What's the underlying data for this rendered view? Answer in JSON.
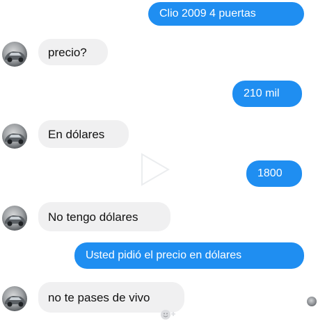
{
  "messages": [
    {
      "id": "m1",
      "from": "me",
      "text": "Clio 2009 4 puertas"
    },
    {
      "id": "m2",
      "from": "contact",
      "text": "precio?"
    },
    {
      "id": "m3",
      "from": "me",
      "text": "210 mil"
    },
    {
      "id": "m4",
      "from": "contact",
      "text": "En dólares"
    },
    {
      "id": "m5",
      "from": "me",
      "text": "1800"
    },
    {
      "id": "m6",
      "from": "contact",
      "text": "No tengo dólares"
    },
    {
      "id": "m7",
      "from": "me",
      "text": "Usted pidió el precio en dólares"
    },
    {
      "id": "m8",
      "from": "contact",
      "text": "no te pases de vivo"
    }
  ],
  "colors": {
    "outgoing_bubble": "#1f8ef1",
    "incoming_bubble": "#f0f0f1",
    "outgoing_text": "#ffffff",
    "incoming_text": "#111111"
  },
  "icons": {
    "contact_avatar": "car-photo-avatar",
    "seen_indicator": "seen-avatar-icon",
    "add_reaction": "smiley-plus-icon"
  }
}
